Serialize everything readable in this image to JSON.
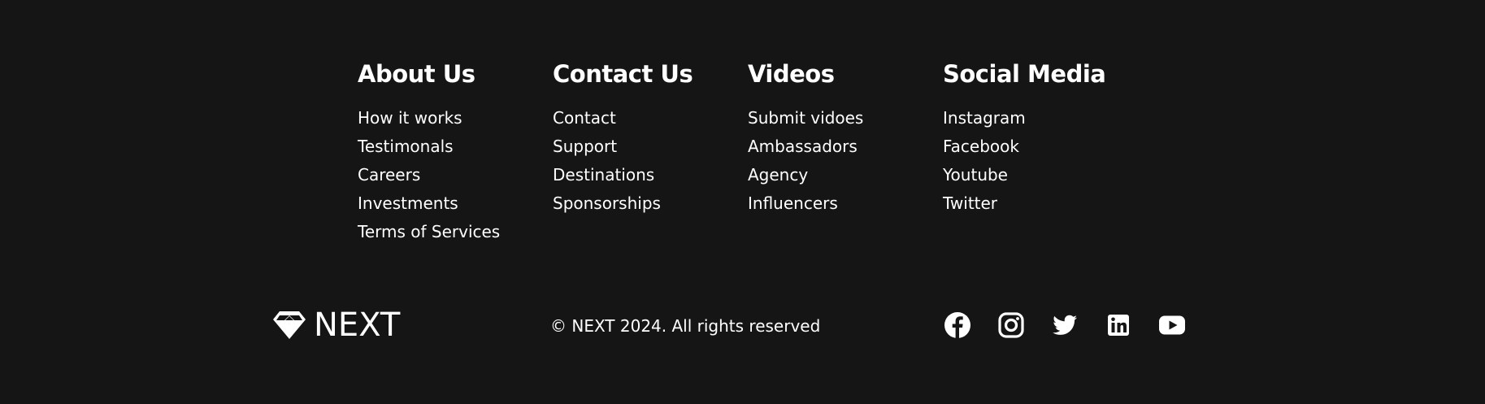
{
  "columns": [
    {
      "heading": "About Us",
      "links": [
        "How it works",
        "Testimonals",
        "Careers",
        "Investments",
        "Terms of Services"
      ]
    },
    {
      "heading": "Contact Us",
      "links": [
        "Contact",
        "Support",
        "Destinations",
        "Sponsorships"
      ]
    },
    {
      "heading": "Videos",
      "links": [
        "Submit vidoes",
        "Ambassadors",
        "Agency",
        "Influencers"
      ]
    },
    {
      "heading": "Social Media",
      "links": [
        "Instagram",
        "Facebook",
        "Youtube",
        "Twitter"
      ]
    }
  ],
  "brand": {
    "name": "NEXT",
    "logo_icon": "diamond-icon"
  },
  "copyright": "© NEXT 2024. All rights reserved",
  "social_icons": [
    "facebook-icon",
    "instagram-icon",
    "twitter-icon",
    "linkedin-icon",
    "youtube-icon"
  ],
  "colors": {
    "background": "#151515",
    "text": "#ffffff"
  }
}
